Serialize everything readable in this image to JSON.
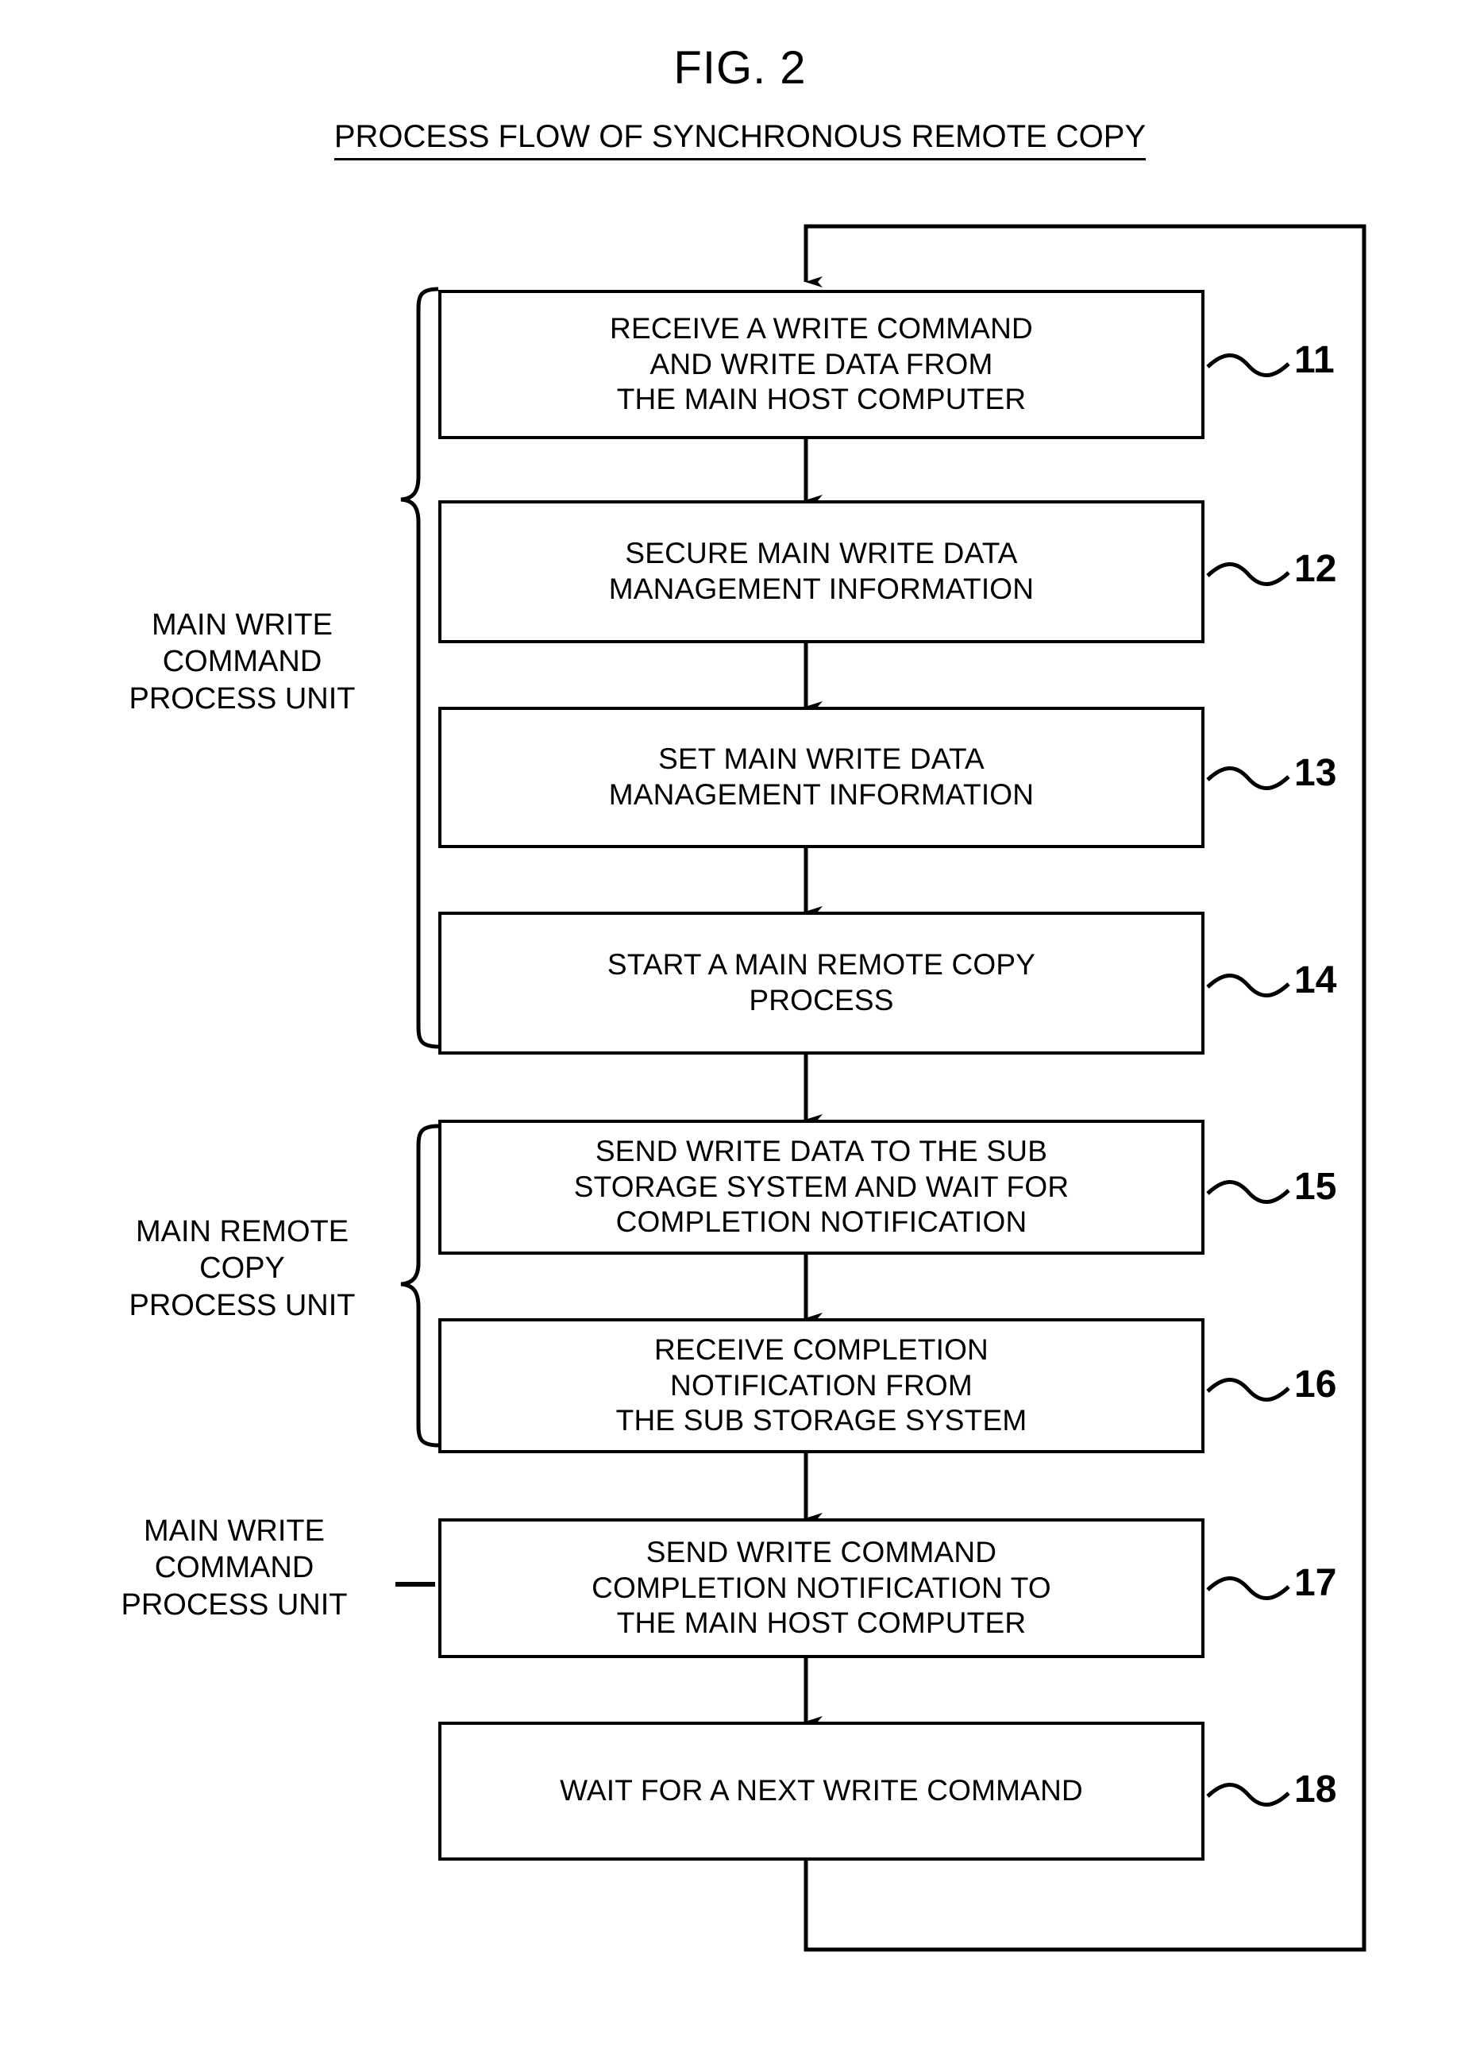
{
  "figure": {
    "title": "FIG. 2",
    "subtitle": "PROCESS FLOW OF SYNCHRONOUS REMOTE COPY"
  },
  "diagram": {
    "type": "flowchart",
    "orientation": "vertical",
    "loop_back": "from step 18 back to the top of step 11",
    "steps": [
      {
        "ref": "11",
        "text": "RECEIVE A WRITE COMMAND\nAND WRITE DATA FROM\nTHE MAIN HOST COMPUTER",
        "group": "MAIN WRITE COMMAND PROCESS UNIT"
      },
      {
        "ref": "12",
        "text": "SECURE MAIN WRITE DATA\nMANAGEMENT INFORMATION",
        "group": "MAIN WRITE COMMAND PROCESS UNIT"
      },
      {
        "ref": "13",
        "text": "SET MAIN WRITE DATA\nMANAGEMENT INFORMATION",
        "group": "MAIN WRITE COMMAND PROCESS UNIT"
      },
      {
        "ref": "14",
        "text": "START A MAIN REMOTE COPY\nPROCESS",
        "group": "MAIN WRITE COMMAND PROCESS UNIT"
      },
      {
        "ref": "15",
        "text": "SEND WRITE DATA TO THE SUB\nSTORAGE SYSTEM AND WAIT FOR\nCOMPLETION NOTIFICATION",
        "group": "MAIN REMOTE COPY PROCESS UNIT"
      },
      {
        "ref": "16",
        "text": "RECEIVE COMPLETION\nNOTIFICATION FROM\nTHE SUB STORAGE SYSTEM",
        "group": "MAIN REMOTE COPY PROCESS UNIT"
      },
      {
        "ref": "17",
        "text": "SEND WRITE COMMAND\nCOMPLETION NOTIFICATION TO\nTHE MAIN HOST COMPUTER",
        "group": "MAIN WRITE COMMAND PROCESS UNIT"
      },
      {
        "ref": "18",
        "text": "WAIT FOR A NEXT WRITE COMMAND",
        "group": ""
      }
    ],
    "group_labels": [
      {
        "text": "MAIN WRITE\nCOMMAND\nPROCESS UNIT",
        "connector": "brace"
      },
      {
        "text": "MAIN REMOTE\nCOPY\nPROCESS UNIT",
        "connector": "brace"
      },
      {
        "text": "MAIN WRITE\nCOMMAND\nPROCESS UNIT",
        "connector": "dash"
      }
    ]
  },
  "colors": {
    "ink": "#000000",
    "paper": "#ffffff"
  }
}
